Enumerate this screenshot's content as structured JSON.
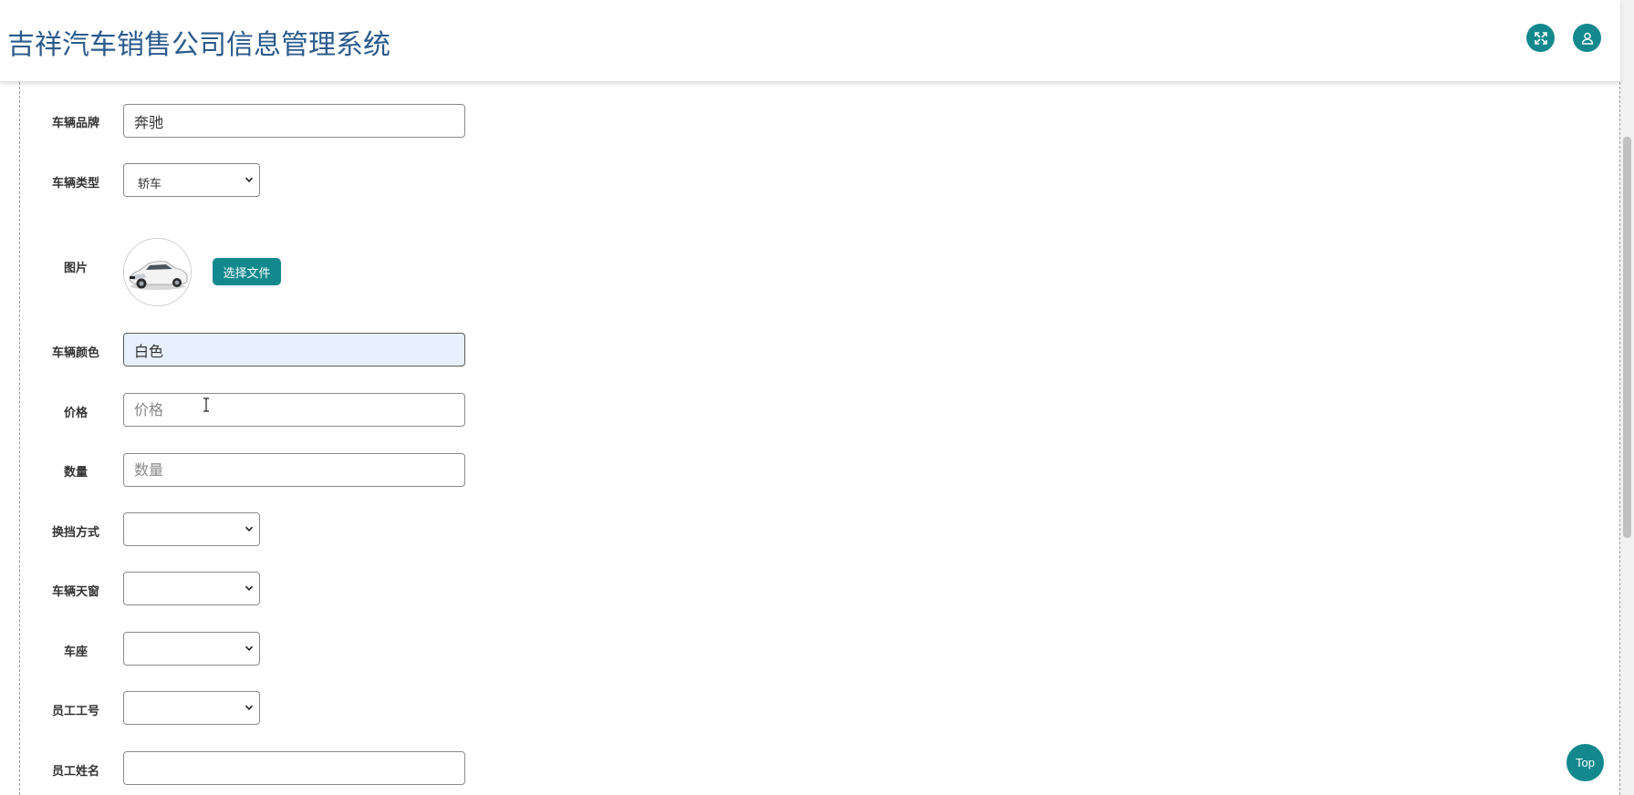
{
  "header": {
    "title": "吉祥汽车销售公司信息管理系统",
    "fullscreen_icon": "expand-arrows-icon",
    "user_icon": "user-icon"
  },
  "form": {
    "brand": {
      "label": "车辆品牌",
      "value": "奔驰"
    },
    "type": {
      "label": "车辆类型",
      "value": "轿车"
    },
    "image": {
      "label": "图片",
      "button": "选择文件"
    },
    "color": {
      "label": "车辆颜色",
      "value": "白色"
    },
    "price": {
      "label": "价格",
      "placeholder": "价格"
    },
    "quantity": {
      "label": "数量",
      "placeholder": "数量"
    },
    "gear": {
      "label": "换挡方式",
      "value": ""
    },
    "sunroof": {
      "label": "车辆天窗",
      "value": ""
    },
    "seat": {
      "label": "车座",
      "value": ""
    },
    "employee_id": {
      "label": "员工工号",
      "value": ""
    },
    "employee_name": {
      "label": "员工姓名",
      "value": ""
    }
  },
  "top_button": "Top",
  "colors": {
    "accent": "#13898d",
    "title": "#2a5a8c",
    "active_field": "#e8f0fe"
  }
}
